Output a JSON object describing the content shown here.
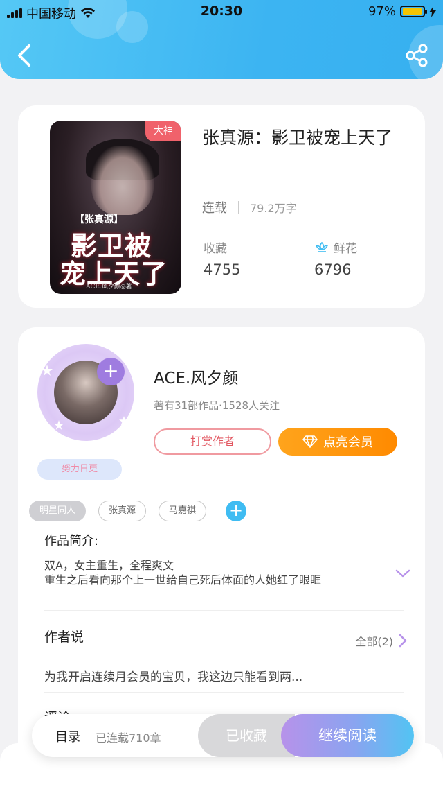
{
  "status_bar": {
    "carrier": "中国移动",
    "time": "20:30",
    "battery": "97%",
    "battery_level": 0.97
  },
  "header": {
    "back_icon": "chevron-left-icon",
    "share_icon": "share-icon"
  },
  "book": {
    "cover_badge": "大神",
    "cover_tag": "【张真源】",
    "cover_title_line1": "影卫被",
    "cover_title_line2": "宠上天了",
    "cover_byline": "ACE.风夕颜◎著",
    "title": "张真源：影卫被宠上天了",
    "status": "连载",
    "word_count": "79.2万字",
    "collect_label": "收藏",
    "collect_count": "4755",
    "flower_label": "鲜花",
    "flower_count": "6796"
  },
  "author": {
    "name": "ACE.风夕颜",
    "meta": "著有31部作品·1528人关注",
    "effort_badge": "努力日更",
    "tip_button": "打赏作者",
    "vip_button": "点亮会员"
  },
  "tags": [
    "明星同人",
    "张真源",
    "马嘉祺"
  ],
  "intro": {
    "heading": "作品简介:",
    "line1": "双A，女主重生，全程爽文",
    "line2": "重生之后看向那个上一世给自己死后体面的人她红了眼眶"
  },
  "author_says": {
    "heading": "作者说",
    "all_label": "全部(2)",
    "text": "为我开启连续月会员的宝贝，我这边只能看到两..."
  },
  "comments": {
    "heading": "评论"
  },
  "bottom_bar": {
    "toc_label": "目录",
    "chapters_label": "已连载710章",
    "saved_button": "已收藏",
    "read_button": "继续阅读"
  },
  "colors": {
    "header_blue": "#3cb4f2",
    "accent_orange": "#ff8a00",
    "accent_purple": "#9f7ce0",
    "tip_red": "#e25660"
  }
}
